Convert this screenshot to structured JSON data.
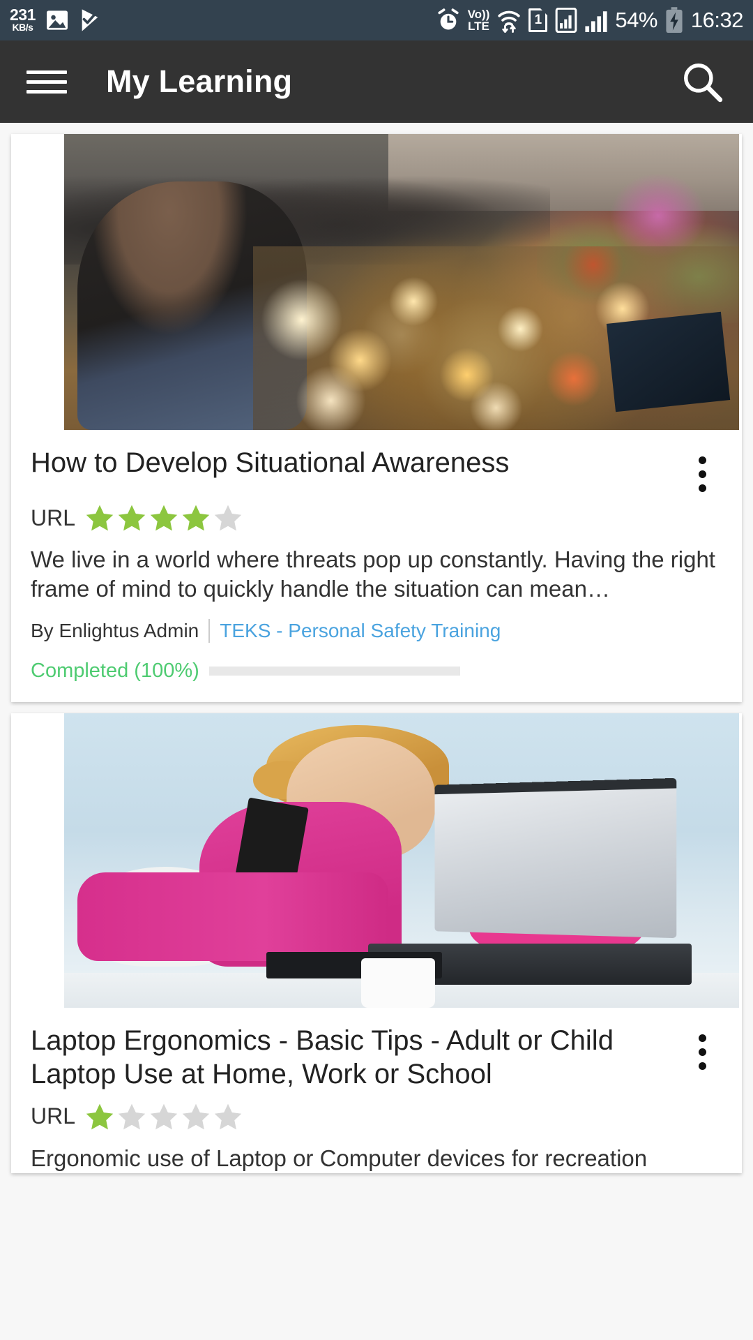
{
  "status_bar": {
    "network_speed_value": "231",
    "network_speed_unit": "KB/s",
    "gallery_icon": "image-icon",
    "play_icon": "play-protect-icon",
    "alarm_icon": "alarm-clock-icon",
    "volte_line1": "Vo))",
    "volte_line2": "LTE",
    "wifi_icon": "wifi-icon",
    "sim_label": "1",
    "signal_boxed_icon": "signal-boxed-icon",
    "signal_icon": "signal-bars-icon",
    "battery_percent": "54%",
    "battery_icon": "battery-charging-icon",
    "clock": "16:32"
  },
  "toolbar": {
    "menu_icon": "hamburger-menu-icon",
    "title": "My Learning",
    "search_icon": "search-icon",
    "background": "#333333"
  },
  "colors": {
    "star_filled": "#8CC63F",
    "star_empty": "#d6d6d6",
    "link": "#4aa3df",
    "progress": "#4ecb71",
    "status_bar": "#33424f"
  },
  "courses": [
    {
      "image_name": "candlelight-vigil-photo",
      "title": "How to Develop Situational Awareness",
      "type_label": "URL",
      "rating": 4,
      "rating_max": 5,
      "description": "We live in a world where threats pop up constantly. Having the right frame of mind to quickly handle the situation can mean…",
      "author": "By Enlightus Admin",
      "category": "TEKS - Personal Safety Training",
      "progress_label": "Completed (100%)",
      "progress_percent": 100,
      "menu_icon": "overflow-menu-icon"
    },
    {
      "image_name": "woman-behind-laptop-photo",
      "title": "Laptop Ergonomics - Basic Tips - Adult or Child Laptop Use at Home, Work or School",
      "type_label": "URL",
      "rating": 1,
      "rating_max": 5,
      "description": "Ergonomic use of Laptop or Computer devices for recreation",
      "menu_icon": "overflow-menu-icon"
    }
  ]
}
